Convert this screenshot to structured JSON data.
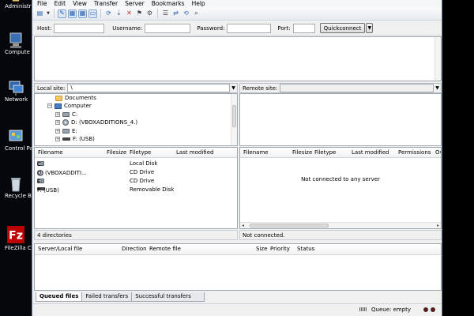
{
  "desktop": {
    "icons": [
      {
        "label": "Administrat",
        "icon": "user-folder-icon"
      },
      {
        "label": "Compute",
        "icon": "computer-icon"
      },
      {
        "label": "Network",
        "icon": "network-icon"
      },
      {
        "label": "Control Pa",
        "icon": "control-panel-icon"
      },
      {
        "label": "Recycle Bi",
        "icon": "recycle-bin-icon"
      },
      {
        "label": "FileZilla Cli",
        "icon": "filezilla-icon"
      }
    ]
  },
  "menu": [
    "File",
    "Edit",
    "View",
    "Transfer",
    "Server",
    "Bookmarks",
    "Help"
  ],
  "toolbar": {
    "icons": [
      "site-manager-icon",
      "toggle-log-icon",
      "toggle-tree-icon",
      "toggle-remote-tree-icon",
      "toggle-queue-icon",
      "refresh-icon",
      "process-queue-icon",
      "cancel-icon",
      "disconnect-icon",
      "reconnect-icon",
      "filter-icon",
      "compare-icon",
      "sync-browse-icon",
      "search-icon"
    ]
  },
  "quickconnect": {
    "host_label": "Host:",
    "host_value": "",
    "username_label": "Username:",
    "username_value": "",
    "password_label": "Password:",
    "password_value": "",
    "port_label": "Port:",
    "port_value": "",
    "button": "Quickconnect"
  },
  "local": {
    "site_label": "Local site:",
    "site_path": "\\",
    "tree": [
      {
        "label": "Documents",
        "icon": "folder-icon",
        "expander": ""
      },
      {
        "label": "Computer",
        "icon": "computer-icon",
        "expander": "−"
      },
      {
        "label": "C:",
        "icon": "disk-icon",
        "expander": "+"
      },
      {
        "label": "D: (VBOXADDITIONS_4.)",
        "icon": "cd-icon",
        "expander": "+"
      },
      {
        "label": "E:",
        "icon": "disk-icon",
        "expander": "+"
      },
      {
        "label": "F: (USB)",
        "icon": "usb-icon",
        "expander": "+"
      }
    ],
    "columns": [
      "Filename",
      "Filesize",
      "Filetype",
      "Last modified"
    ],
    "files": [
      {
        "name": "C:",
        "type": "Local Disk",
        "icon": "disk-icon"
      },
      {
        "name": "D: (VBOXADDITI...",
        "type": "CD Drive",
        "icon": "cd-icon"
      },
      {
        "name": "E:",
        "type": "CD Drive",
        "icon": "disk-icon"
      },
      {
        "name": "F: (USB)",
        "type": "Removable Disk",
        "icon": "usb-icon"
      }
    ],
    "status": "4 directories"
  },
  "remote": {
    "site_label": "Remote site:",
    "site_path": "",
    "columns": [
      "Filename",
      "Filesize",
      "Filetype",
      "Last modified",
      "Permissions",
      "Ov"
    ],
    "message": "Not connected to any server",
    "status": "Not connected."
  },
  "queue": {
    "columns": [
      "Server/Local file",
      "Direction",
      "Remote file",
      "Size",
      "Priority",
      "Status"
    ],
    "tabs": [
      "Queued files",
      "Failed transfers",
      "Successful transfers"
    ]
  },
  "statusbar": {
    "queue_text": "Queue: empty"
  }
}
